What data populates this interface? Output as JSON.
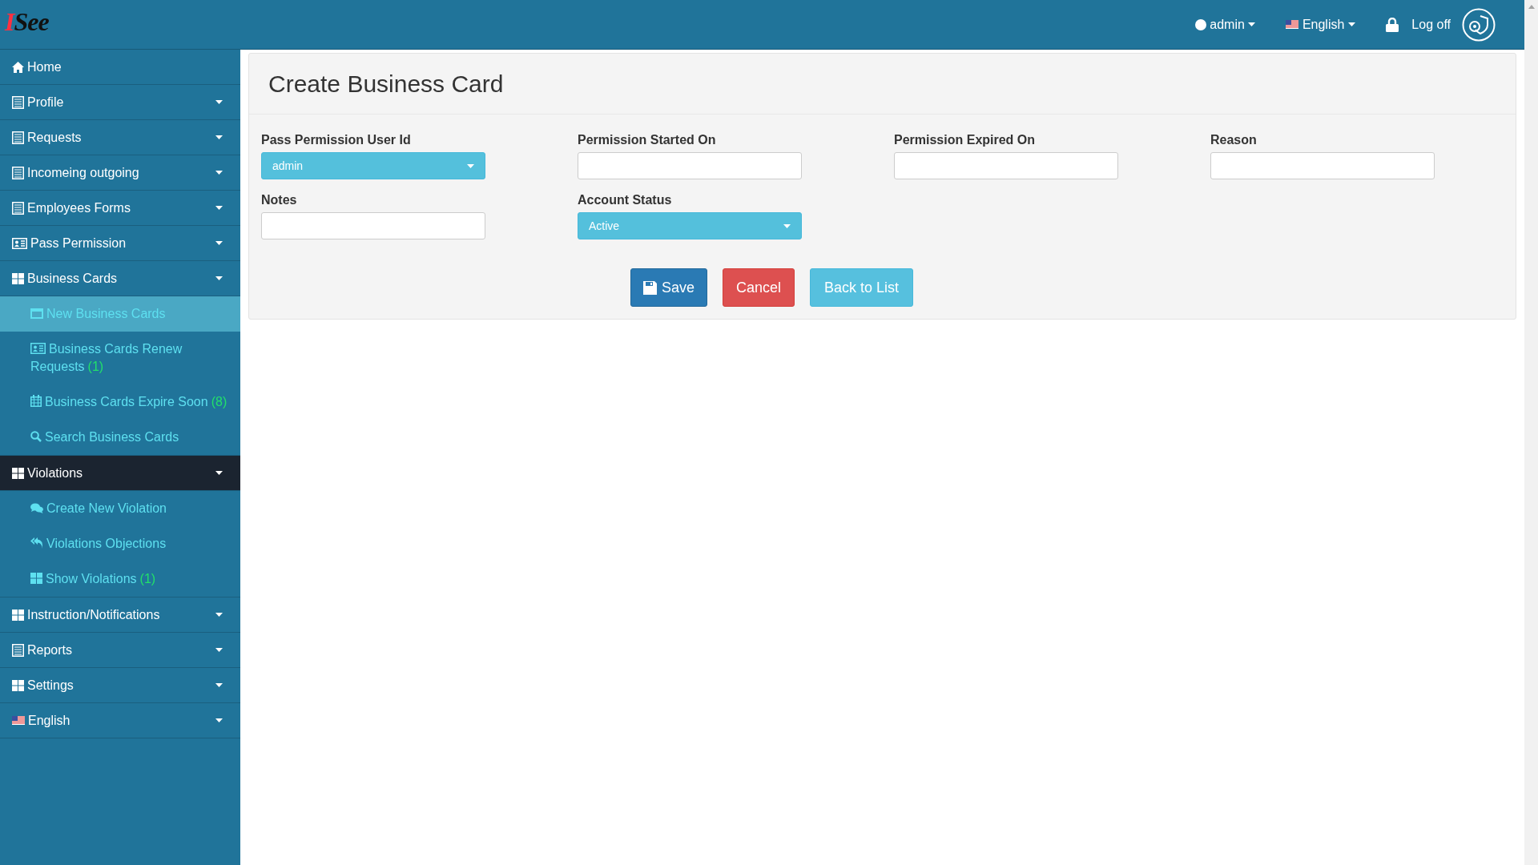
{
  "topbar": {
    "logo": {
      "initial": "I",
      "rest": "See"
    },
    "user": "admin",
    "language": "English",
    "logoff": "Log off"
  },
  "sidebar": {
    "items": [
      {
        "label": "Home",
        "kind": "home",
        "expandable": false,
        "highlighted": false
      },
      {
        "label": "Profile",
        "kind": "list",
        "expandable": true,
        "highlighted": false
      },
      {
        "label": "Requests",
        "kind": "list",
        "expandable": true,
        "highlighted": false
      },
      {
        "label": "Incomeing outgoing",
        "kind": "list",
        "expandable": true,
        "highlighted": false
      },
      {
        "label": "Employees Forms",
        "kind": "list",
        "expandable": true,
        "highlighted": false
      },
      {
        "label": "Pass Permission",
        "kind": "idcard",
        "expandable": true,
        "highlighted": false
      },
      {
        "label": "Business Cards",
        "kind": "grid",
        "expandable": true,
        "highlighted": false,
        "children": [
          {
            "label": "New Business Cards",
            "kind": "window",
            "selected": true
          },
          {
            "label": "Business Cards Renew Requests",
            "kind": "idcard",
            "count": "(1)",
            "selected": false
          },
          {
            "label": "Business Cards Expire Soon",
            "kind": "calendar",
            "count": "(8)",
            "selected": false
          },
          {
            "label": "Search Business Cards",
            "kind": "search",
            "selected": false
          }
        ]
      },
      {
        "label": "Violations",
        "kind": "grid",
        "expandable": true,
        "highlighted": true,
        "children": [
          {
            "label": "Create New Violation",
            "kind": "comments",
            "selected": false
          },
          {
            "label": "Violations Objections",
            "kind": "reply",
            "selected": false
          },
          {
            "label": "Show Violations",
            "kind": "grid",
            "count": "(1)",
            "selected": false
          }
        ]
      },
      {
        "label": "Instruction/Notifications",
        "kind": "grid",
        "expandable": true,
        "highlighted": false
      },
      {
        "label": "Reports",
        "kind": "list",
        "expandable": true,
        "highlighted": false
      },
      {
        "label": "Settings",
        "kind": "grid",
        "expandable": true,
        "highlighted": false
      },
      {
        "label": "English",
        "kind": "flag",
        "expandable": true,
        "highlighted": false
      }
    ]
  },
  "form": {
    "title": "Create Business Card",
    "fields": [
      {
        "label": "Pass Permission User Id",
        "kind": "select",
        "value": "admin"
      },
      {
        "label": "Permission Started On",
        "kind": "text"
      },
      {
        "label": "Permission Expired On",
        "kind": "text"
      },
      {
        "label": "Reason",
        "kind": "text"
      },
      {
        "label": "Notes",
        "kind": "text"
      },
      {
        "label": "Account Status",
        "kind": "select",
        "value": "Active"
      }
    ],
    "buttons": [
      {
        "label": "Save",
        "kind": "primary"
      },
      {
        "label": "Cancel",
        "kind": "danger"
      },
      {
        "label": "Back to List",
        "kind": "info"
      }
    ]
  }
}
